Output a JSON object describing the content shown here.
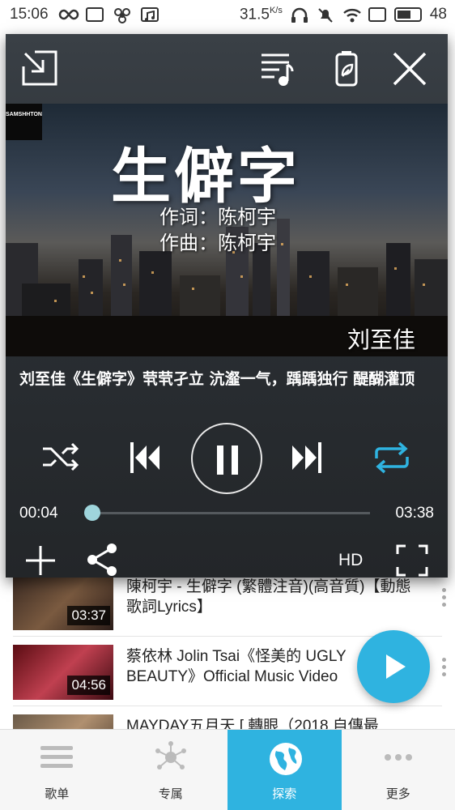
{
  "status_bar": {
    "time": "15:06",
    "net_speed": "31.5",
    "net_unit": "K/s",
    "battery": "48"
  },
  "player": {
    "video": {
      "channel_logo": "SAMSHHTON",
      "song_title": "生僻字",
      "lyricist": "作词：陈柯宇",
      "composer": "作曲：陈柯宇",
      "artist": "刘至佳"
    },
    "title": "刘至佳《生僻字》茕茕孑立 沆瀣一气，踽踽独行 醍醐灌顶",
    "current_time": "00:04",
    "total_time": "03:38",
    "progress_fraction": 0.02,
    "quality": "HD",
    "colors": {
      "accent": "#2fb3e0",
      "knob": "#9fd5dc"
    },
    "icons": [
      "minimize-icon",
      "playlist-icon",
      "battery-saver-icon",
      "close-icon",
      "shuffle-icon",
      "previous-icon",
      "pause-icon",
      "next-icon",
      "repeat-icon",
      "add-icon",
      "share-icon",
      "fullscreen-icon"
    ]
  },
  "list": [
    {
      "title": "陳柯宇 - 生僻字 (繁體注音)(高音質)【動態歌詞Lyrics】",
      "duration": "03:37"
    },
    {
      "title": "蔡依林 Jolin Tsai《怪美的 UGLY BEAUTY》Official Music Video",
      "duration": "04:56"
    },
    {
      "title": "MAYDAY五月天 [ 轉眼（2018 自傳最",
      "duration": ""
    }
  ],
  "bottom_nav": {
    "tabs": [
      {
        "label": "歌单",
        "icon": "list-icon"
      },
      {
        "label": "专属",
        "icon": "network-icon"
      },
      {
        "label": "探索",
        "icon": "globe-icon",
        "active": true
      },
      {
        "label": "更多",
        "icon": "more-dots-icon"
      }
    ]
  }
}
